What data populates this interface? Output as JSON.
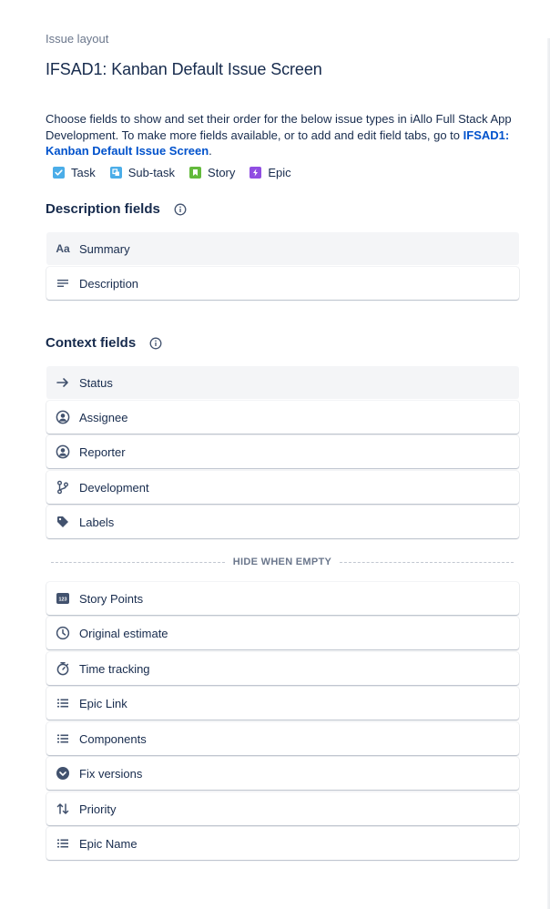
{
  "breadcrumb": "Issue layout",
  "title": "IFSAD1: Kanban Default Issue Screen",
  "description": {
    "text": "Choose fields to show and set their order for the below issue types in iAllo Full Stack App Development. To make more fields available, or to add and edit field tabs, go to ",
    "link": "IFSAD1: Kanban Default Issue Screen",
    "suffix": "."
  },
  "issue_types": [
    {
      "label": "Task",
      "color": "#4bade8",
      "icon": "task-check-icon"
    },
    {
      "label": "Sub-task",
      "color": "#4bade8",
      "icon": "subtask-icon"
    },
    {
      "label": "Story",
      "color": "#63ba3c",
      "icon": "story-bookmark-icon"
    },
    {
      "label": "Epic",
      "color": "#904ee2",
      "icon": "epic-lightning-icon"
    }
  ],
  "description_fields": {
    "title": "Description fields",
    "items": [
      {
        "label": "Summary",
        "icon": "text-aa-icon"
      },
      {
        "label": "Description",
        "icon": "paragraph-lines-icon"
      }
    ]
  },
  "context_fields": {
    "title": "Context fields",
    "items": [
      {
        "label": "Status",
        "icon": "arrow-right-icon"
      },
      {
        "label": "Assignee",
        "icon": "person-circle-icon"
      },
      {
        "label": "Reporter",
        "icon": "person-circle-icon"
      },
      {
        "label": "Development",
        "icon": "branch-icon"
      },
      {
        "label": "Labels",
        "icon": "tag-icon"
      }
    ]
  },
  "hide_when_empty": {
    "label": "HIDE WHEN EMPTY",
    "items": [
      {
        "label": "Story Points",
        "icon": "number-123-icon"
      },
      {
        "label": "Original estimate",
        "icon": "clock-icon"
      },
      {
        "label": "Time tracking",
        "icon": "stopwatch-icon"
      },
      {
        "label": "Epic Link",
        "icon": "list-icon"
      },
      {
        "label": "Components",
        "icon": "list-icon"
      },
      {
        "label": "Fix versions",
        "icon": "chevron-circle-icon"
      },
      {
        "label": "Priority",
        "icon": "sort-arrows-icon"
      },
      {
        "label": "Epic Name",
        "icon": "list-icon"
      }
    ]
  },
  "colors": {
    "text": "#172b4d",
    "subtle": "#6b778c",
    "link": "#0052cc",
    "icon": "#42526e"
  }
}
